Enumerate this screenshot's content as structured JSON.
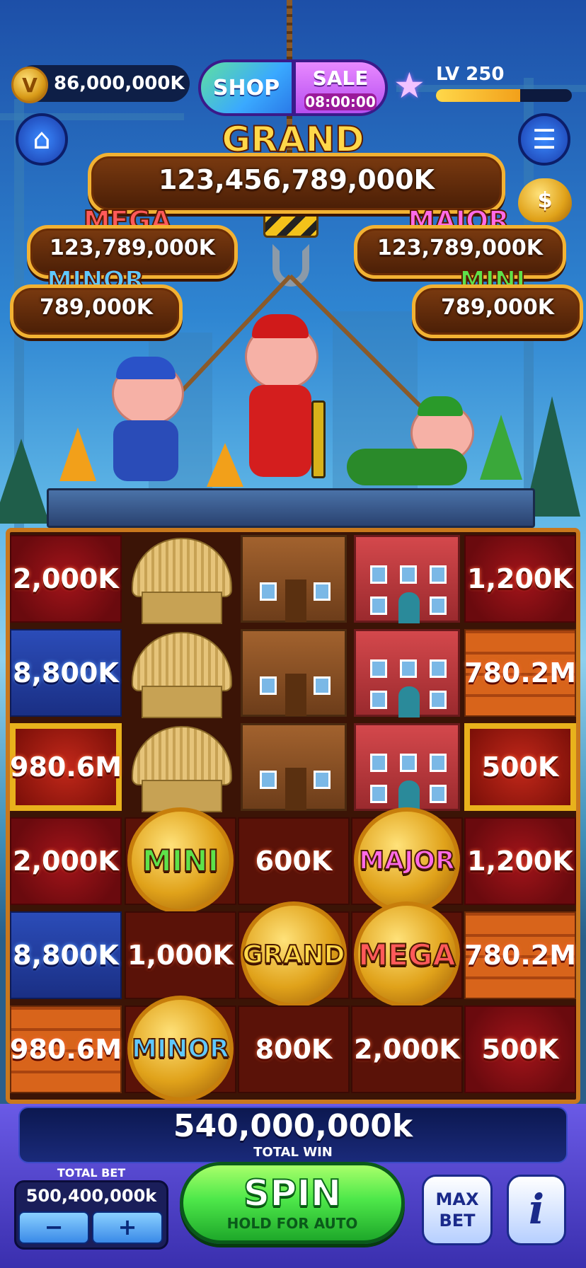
{
  "header": {
    "coins": "86,000,000K",
    "coin_symbol": "V",
    "shop_label": "SHOP",
    "sale_label": "SALE",
    "sale_timer": "08:00:00",
    "level_label": "LV 250",
    "level_progress": 0.62
  },
  "jackpots": {
    "grand": {
      "label": "GRAND",
      "value": "123,456,789,000K"
    },
    "mega": {
      "label": "MEGA",
      "value": "123,789,000K"
    },
    "major": {
      "label": "MAJOR",
      "value": "123,789,000K"
    },
    "minor": {
      "label": "MINOR",
      "value": "789,000K"
    },
    "mini": {
      "label": "MINI",
      "value": "789,000K"
    }
  },
  "reels": {
    "col1": [
      "2,000K",
      "8,800K",
      "980.6M",
      "2,000K",
      "8,800K",
      "980.6M"
    ],
    "col2": [
      "MINI",
      "1,000K",
      "MINOR"
    ],
    "col3": [
      "600K",
      "GRAND",
      "800K"
    ],
    "col4": [
      "MAJOR",
      "MEGA",
      "2,000K"
    ],
    "col5": [
      "1,200K",
      "780.2M",
      "500K",
      "1,200K",
      "780.2M",
      "500K"
    ]
  },
  "footer": {
    "total_win_value": "540,000,000k",
    "total_win_label": "TOTAL WIN",
    "total_bet_label": "TOTAL BET",
    "total_bet_value": "500,400,000k",
    "minus_label": "−",
    "plus_label": "+",
    "spin_label": "SPIN",
    "spin_sub": "HOLD FOR AUTO",
    "max_label": "MAX",
    "bet_label": "BET",
    "info_label": "i"
  },
  "colors": {
    "accent_gold": "#f2b233",
    "mini_green": "#5ee24a",
    "minor_blue": "#5fc8ff",
    "major_magenta": "#ff6ae8",
    "mega_red": "#ff5a5a",
    "spin_green": "#4ee84a"
  }
}
